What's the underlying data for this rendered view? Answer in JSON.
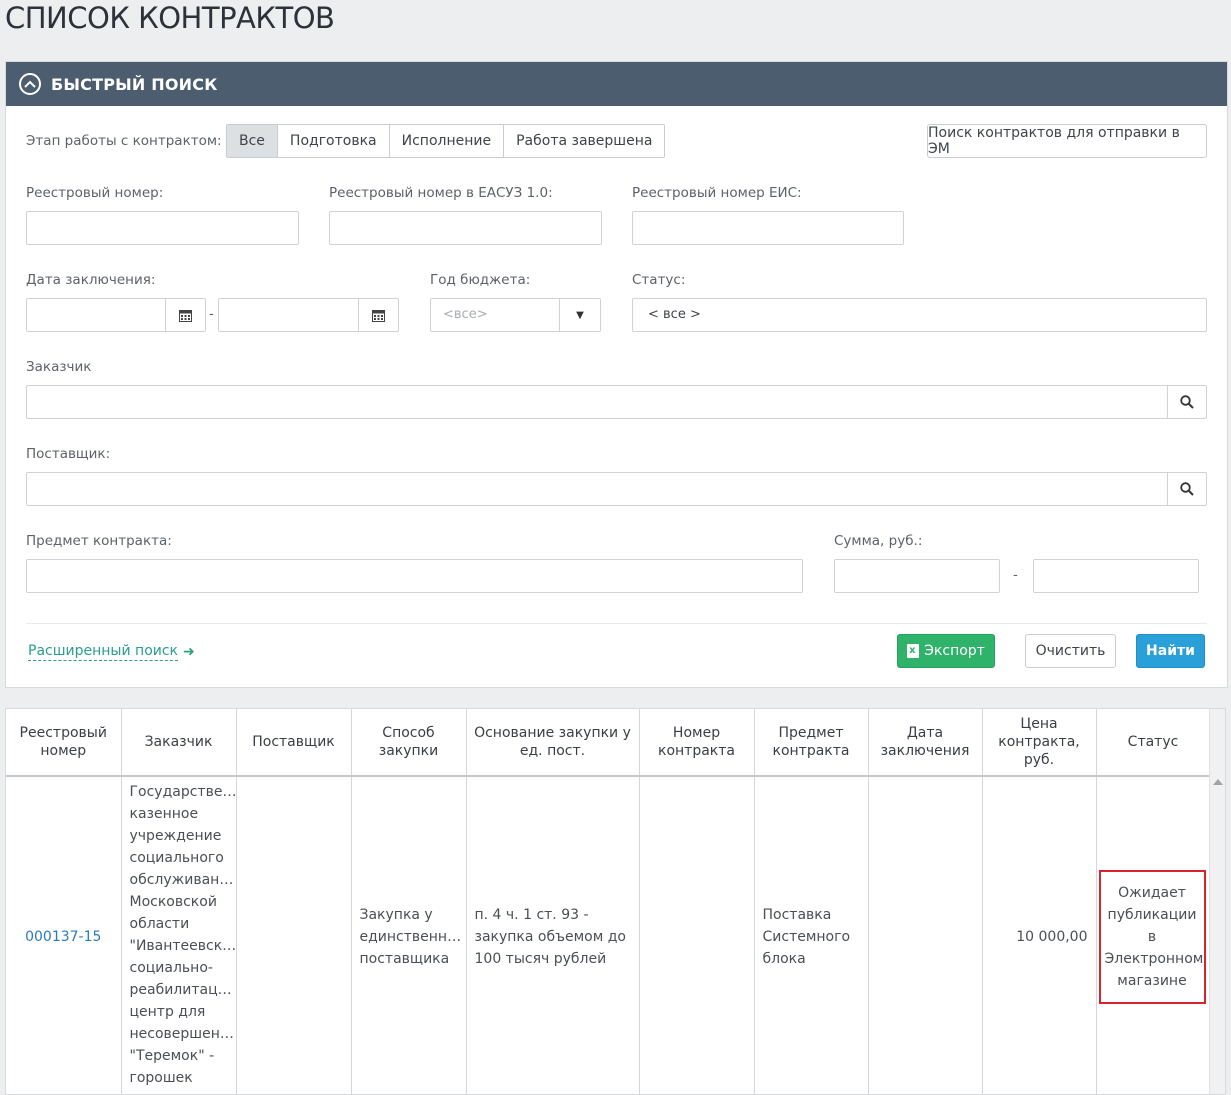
{
  "page": {
    "title": "СПИСОК КОНТРАКТОВ"
  },
  "quick_search": {
    "title": "БЫСТРЫЙ ПОИСК",
    "stage_label": "Этап работы с контрактом:",
    "stages": [
      "Все",
      "Подготовка",
      "Исполнение",
      "Работа завершена"
    ],
    "em_search_button": "Поиск контрактов для отправки в ЭМ",
    "reg_number_label": "Реестровый номер:",
    "reg_number_easuz_label": "Реестровый номер в ЕАСУЗ 1.0:",
    "reg_number_eis_label": "Реестровый номер ЕИС:",
    "date_label": "Дата заключения:",
    "date_separator": "-",
    "budget_year_label": "Год бюджета:",
    "budget_year_value": "<все>",
    "status_label": "Статус:",
    "status_value": "< все >",
    "customer_label": "Заказчик",
    "supplier_label": "Поставщик:",
    "subject_label": "Предмет контракта:",
    "sum_label": "Сумма, руб.:",
    "sum_separator": "-",
    "advanced_search": "Расширенный поиск",
    "export_button": "Экспорт",
    "clear_button": "Очистить",
    "find_button": "Найти"
  },
  "table": {
    "headers": [
      "Реестровый номер",
      "Заказчик",
      "Поставщик",
      "Способ закупки",
      "Основание закупки у ед. пост.",
      "Номер контракта",
      "Предмет контракта",
      "Дата заключения",
      "Цена контракта, руб.",
      "Статус"
    ],
    "rows": [
      {
        "reg_number": "000137-15",
        "customer": [
          "Государстве…",
          "казенное",
          "учреждение",
          "социального",
          "обслуживан…",
          "Московской",
          "области",
          "\"Ивантеевск…",
          "социально-",
          "реабилитац…",
          "центр для",
          "несовершен…",
          "\"Теремок\" -",
          "горошек"
        ],
        "supplier": "",
        "method": [
          "Закупка у",
          "единственн…",
          "поставщика"
        ],
        "basis": [
          "п. 4 ч. 1 ст. 93 -",
          "закупка объемом до",
          "100 тысяч рублей"
        ],
        "contract_number": "",
        "subject": [
          "Поставка",
          "Системного",
          "блока"
        ],
        "date": "",
        "price": "10 000,00",
        "status": [
          "Ожидает",
          "публикации в",
          "Электронном",
          "магазине"
        ]
      }
    ]
  },
  "colors": {
    "header_bg": "#4d5d70",
    "export": "#2fb36a",
    "find": "#2aa0d8",
    "link": "#2a9d8f",
    "status_highlight": "#d9232d"
  }
}
